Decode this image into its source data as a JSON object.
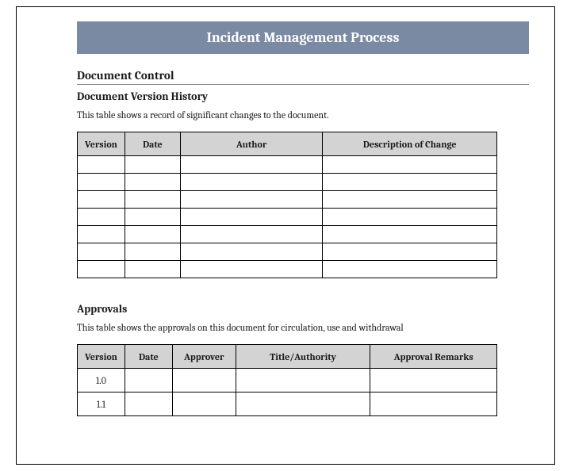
{
  "title": "Incident Management Process",
  "section1_heading": "Document Control",
  "section1_sub": "Document Version History",
  "section1_desc": "This table shows a record of significant changes to the document.",
  "history_table": {
    "headers": [
      "Version",
      "Date",
      "Author",
      "Description of Change"
    ],
    "rows": [
      [
        "",
        "",
        "",
        ""
      ],
      [
        "",
        "",
        "",
        ""
      ],
      [
        "",
        "",
        "",
        ""
      ],
      [
        "",
        "",
        "",
        ""
      ],
      [
        "",
        "",
        "",
        ""
      ],
      [
        "",
        "",
        "",
        ""
      ],
      [
        "",
        "",
        "",
        ""
      ]
    ]
  },
  "section2_heading": "Approvals",
  "section2_desc": "This table shows the approvals on this document for circulation, use and withdrawal",
  "approvals_table": {
    "headers": [
      "Version",
      "Date",
      "Approver",
      "Title/Authority",
      "Approval Remarks"
    ],
    "rows": [
      [
        "1.0",
        "",
        "",
        "",
        ""
      ],
      [
        "1.1",
        "",
        "",
        "",
        ""
      ]
    ]
  }
}
